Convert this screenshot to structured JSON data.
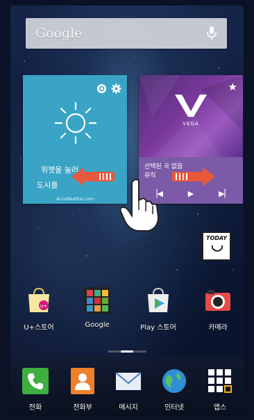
{
  "search": {
    "logo": "Google"
  },
  "weather": {
    "line1": "위젯을 눌러",
    "line2": "도시를",
    "source": "AccuWeather.com"
  },
  "music": {
    "brand": "VEGA",
    "title_line1": "선택된 곡 없음",
    "title_line2": "뮤직",
    "controls": [
      "prev",
      "play",
      "next"
    ]
  },
  "today": {
    "label": "TODAY"
  },
  "apps": [
    {
      "label": "U+스토어",
      "icon": "uplus-store-icon"
    },
    {
      "label": "Google",
      "icon": "google-folder-icon"
    },
    {
      "label": "Play 스토어",
      "icon": "play-store-icon"
    },
    {
      "label": "카메라",
      "icon": "camera-icon"
    }
  ],
  "dock": [
    {
      "label": "전화",
      "icon": "phone-icon"
    },
    {
      "label": "전화부",
      "icon": "contacts-icon"
    },
    {
      "label": "메시지",
      "icon": "messages-icon"
    },
    {
      "label": "인터넷",
      "icon": "internet-icon"
    },
    {
      "label": "앱스",
      "icon": "apps-grid-icon"
    }
  ],
  "colors": {
    "weather_bg": "#3aa4c6",
    "music_bg": "#7b5aa8",
    "arrow": "#e8583c"
  }
}
